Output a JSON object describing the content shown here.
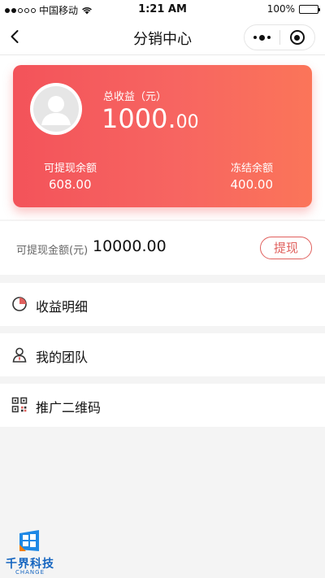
{
  "status_bar": {
    "carrier": "中国移动",
    "time": "1:21 AM",
    "battery": "100%"
  },
  "nav": {
    "title": "分销中心"
  },
  "earnings": {
    "total_label": "总收益（元）",
    "total_int": "1000.",
    "total_dec": "00",
    "available_label": "可提现余额",
    "available_value": "608.00",
    "frozen_label": "冻结余额",
    "frozen_value": "400.00"
  },
  "withdraw": {
    "label": "可提现金额(元)",
    "value": "10000.00",
    "button": "提现"
  },
  "menu": [
    {
      "label": "收益明细",
      "icon": "pie-chart-icon"
    },
    {
      "label": "我的团队",
      "icon": "user-icon"
    },
    {
      "label": "推广二维码",
      "icon": "qr-code-icon"
    }
  ],
  "watermark": {
    "title": "千界科技",
    "subtitle": "CHANGE"
  },
  "colors": {
    "accent": "#e0605d",
    "card_start": "#f3535a",
    "card_end": "#fb7559",
    "logo": "#1565c0"
  }
}
